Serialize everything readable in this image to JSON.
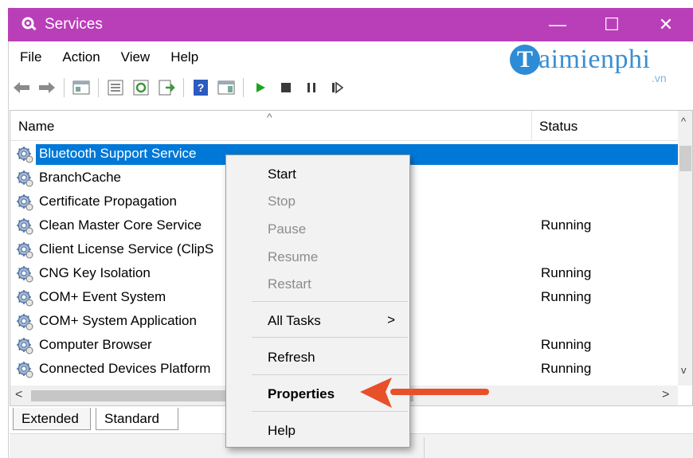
{
  "window": {
    "title": "Services",
    "minimize_glyph": "—",
    "maximize_glyph": "☐",
    "close_glyph": "✕",
    "title_bar_color": "#b93fb8"
  },
  "menu": [
    "File",
    "Action",
    "View",
    "Help"
  ],
  "watermark": {
    "logo_letter": "T",
    "word": "aimienphi",
    "suffix": ".vn"
  },
  "toolbar_icons": [
    "back-arrow-icon",
    "forward-arrow-icon",
    "show-console-tree-icon",
    "properties-icon",
    "refresh-icon",
    "export-list-icon",
    "help-icon",
    "show-action-pane-icon",
    "start-service-icon",
    "stop-service-icon",
    "pause-service-icon",
    "restart-service-icon"
  ],
  "columns": {
    "name": "Name",
    "status": "Status",
    "sort_caret": "^"
  },
  "services": [
    {
      "name": "Bluetooth Support Service",
      "status": ""
    },
    {
      "name": "BranchCache",
      "status": ""
    },
    {
      "name": "Certificate Propagation",
      "status": ""
    },
    {
      "name": "Clean Master Core Service",
      "status": "Running"
    },
    {
      "name": "Client License Service (ClipS",
      "status": ""
    },
    {
      "name": "CNG Key Isolation",
      "status": "Running"
    },
    {
      "name": "COM+ Event System",
      "status": "Running"
    },
    {
      "name": "COM+ System Application",
      "status": ""
    },
    {
      "name": "Computer Browser",
      "status": "Running"
    },
    {
      "name": "Connected Devices Platform",
      "status": "Running"
    }
  ],
  "selected_index": 0,
  "scroll": {
    "up": "^",
    "down": "v",
    "left": "<",
    "right": ">"
  },
  "tabs": [
    "Extended",
    "Standard"
  ],
  "context_menu": {
    "start": "Start",
    "stop": "Stop",
    "pause": "Pause",
    "resume": "Resume",
    "restart": "Restart",
    "all_tasks": "All Tasks",
    "submenu_arrow": ">",
    "refresh": "Refresh",
    "properties": "Properties",
    "help": "Help"
  },
  "colors": {
    "selection": "#0078d7",
    "annotation_arrow": "#e8502a"
  }
}
